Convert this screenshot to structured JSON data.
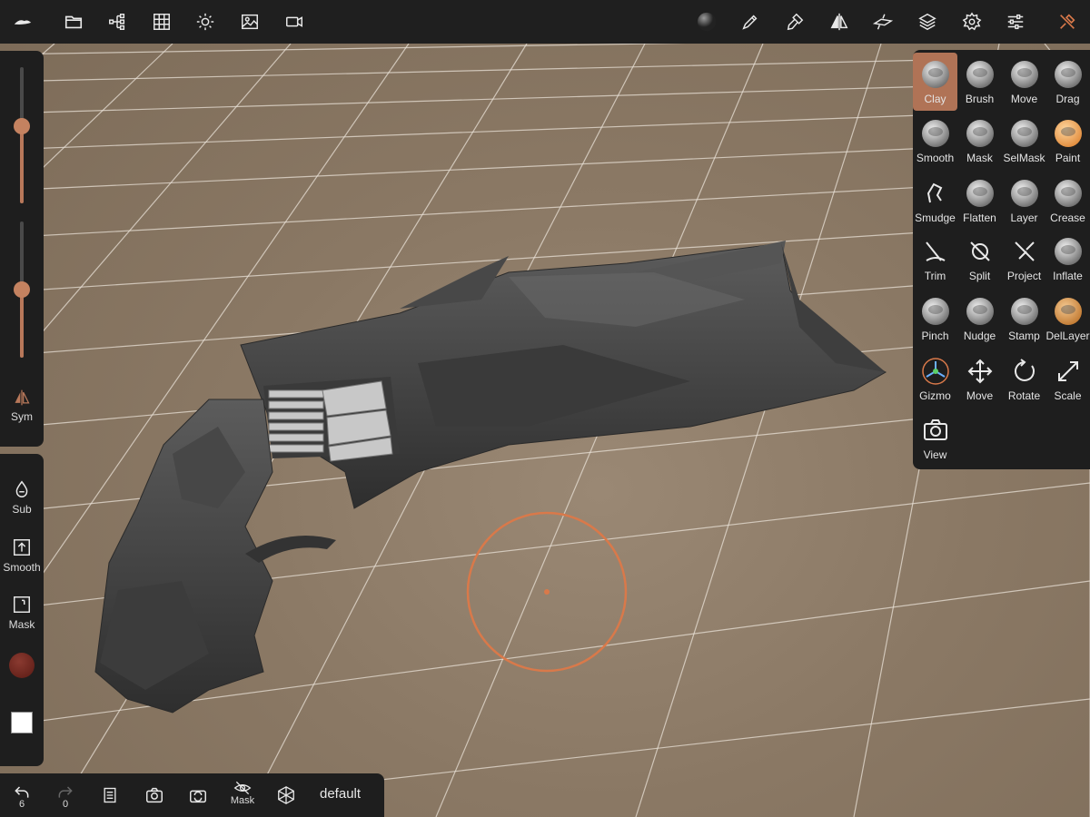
{
  "topbar": {
    "left_icons": [
      "nomad-logo-icon",
      "folder-icon",
      "scene-tree-icon",
      "topology-grid-icon",
      "light-icon",
      "background-image-icon",
      "video-icon"
    ],
    "right_icons": [
      "matcap-sphere-icon",
      "painting-icon",
      "stroke-brush-icon",
      "symmetry-icon",
      "camera-rig-icon",
      "layers-icon",
      "settings-icon",
      "sliders-icon",
      "tools-wrench-icon"
    ],
    "accent": "#d9794a"
  },
  "left_panel": {
    "sym_label": "Sym",
    "radius_level": 0.57,
    "intensity_level": 0.5,
    "sub_label": "Sub",
    "smooth_label": "Smooth",
    "mask_label": "Mask",
    "color_swatch": "#5a1a14",
    "secondary_swatch": "#ffffff"
  },
  "tools": [
    {
      "label": "Clay",
      "icon": "clay-sphere-icon",
      "active": true
    },
    {
      "label": "Brush",
      "icon": "brush-sphere-icon"
    },
    {
      "label": "Move",
      "icon": "move-sphere-icon"
    },
    {
      "label": "Drag",
      "icon": "drag-sphere-icon"
    },
    {
      "label": "Smooth",
      "icon": "smooth-sphere-icon"
    },
    {
      "label": "Mask",
      "icon": "mask-sphere-icon"
    },
    {
      "label": "SelMask",
      "icon": "selmask-sphere-icon"
    },
    {
      "label": "Paint",
      "icon": "paint-sphere-icon"
    },
    {
      "label": "Smudge",
      "icon": "smudge-icon"
    },
    {
      "label": "Flatten",
      "icon": "flatten-sphere-icon"
    },
    {
      "label": "Layer",
      "icon": "layer-sphere-icon"
    },
    {
      "label": "Crease",
      "icon": "crease-sphere-icon"
    },
    {
      "label": "Trim",
      "icon": "trim-icon"
    },
    {
      "label": "Split",
      "icon": "split-icon"
    },
    {
      "label": "Project",
      "icon": "project-icon"
    },
    {
      "label": "Inflate",
      "icon": "inflate-sphere-icon"
    },
    {
      "label": "Pinch",
      "icon": "pinch-sphere-icon"
    },
    {
      "label": "Nudge",
      "icon": "nudge-sphere-icon"
    },
    {
      "label": "Stamp",
      "icon": "stamp-sphere-icon"
    },
    {
      "label": "DelLayer",
      "icon": "dellayer-sphere-icon"
    },
    {
      "label": "Gizmo",
      "icon": "gizmo-icon"
    },
    {
      "label": "Move",
      "icon": "move-arrows-icon"
    },
    {
      "label": "Rotate",
      "icon": "rotate-icon"
    },
    {
      "label": "Scale",
      "icon": "scale-icon"
    },
    {
      "label": "View",
      "icon": "camera-icon"
    }
  ],
  "bottombar": {
    "undo_count": "6",
    "redo_count": "0",
    "mask_label": "Mask",
    "preset_label": "default"
  }
}
